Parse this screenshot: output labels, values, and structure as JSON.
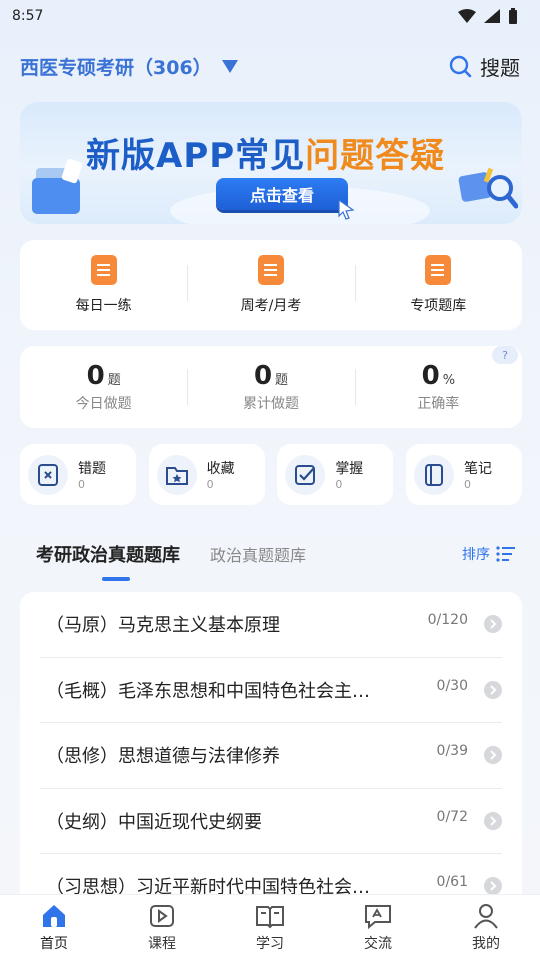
{
  "status": {
    "time": "8:57"
  },
  "header": {
    "subject": "西医专硕考研（306）",
    "search_label": "搜题"
  },
  "banner": {
    "title_main": "新版APP常见",
    "title_accent": "问题答疑",
    "button": "点击查看"
  },
  "practice": [
    {
      "label": "每日一练",
      "icon": "daily-practice-icon"
    },
    {
      "label": "周考/月考",
      "icon": "exam-icon"
    },
    {
      "label": "专项题库",
      "icon": "question-bank-icon"
    }
  ],
  "stats": [
    {
      "value": "0",
      "unit": "题",
      "label": "今日做题"
    },
    {
      "value": "0",
      "unit": "题",
      "label": "累计做题"
    },
    {
      "value": "0",
      "unit": "%",
      "label": "正确率"
    }
  ],
  "help": "?",
  "tools": [
    {
      "name": "错题",
      "count": "0",
      "icon": "wrong-questions-icon"
    },
    {
      "name": "收藏",
      "count": "0",
      "icon": "favorites-icon"
    },
    {
      "name": "掌握",
      "count": "0",
      "icon": "mastered-icon"
    },
    {
      "name": "笔记",
      "count": "0",
      "icon": "notes-icon"
    }
  ],
  "tabs": {
    "active": "考研政治真题题库",
    "other": "政治真题题库",
    "sort": "排序"
  },
  "list": [
    {
      "title": "（马原）马克思主义基本原理",
      "count": "0/120"
    },
    {
      "title": "（毛概）毛泽东思想和中国特色社会主…",
      "count": "0/30"
    },
    {
      "title": "（思修）思想道德与法律修养",
      "count": "0/39"
    },
    {
      "title": "（史纲）中国近现代史纲要",
      "count": "0/72"
    },
    {
      "title": "（习思想）习近平新时代中国特色社会…",
      "count": "0/61"
    }
  ],
  "nav": [
    {
      "label": "首页",
      "icon": "home-icon"
    },
    {
      "label": "课程",
      "icon": "course-icon"
    },
    {
      "label": "学习",
      "icon": "study-icon"
    },
    {
      "label": "交流",
      "icon": "community-icon"
    },
    {
      "label": "我的",
      "icon": "profile-icon"
    }
  ],
  "colors": {
    "accent": "#2f74e8",
    "orange": "#f7893a"
  }
}
